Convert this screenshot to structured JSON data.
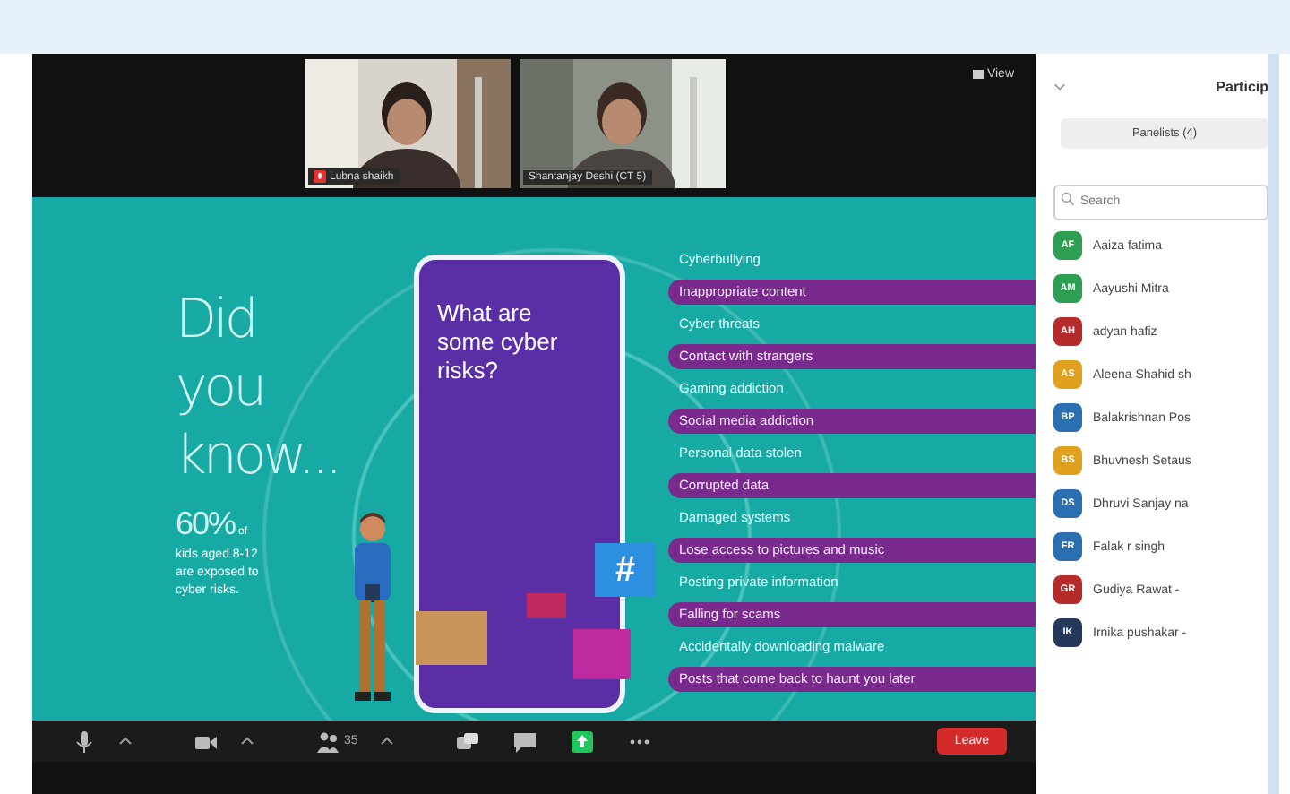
{
  "videos": [
    {
      "name": "Lubna shaikh",
      "muted": true
    },
    {
      "name": "Shantanjay Deshi (CT 5)",
      "muted": false
    }
  ],
  "view_button": "View",
  "slide": {
    "heading": [
      "Did",
      "you",
      "know..."
    ],
    "stat": "60%",
    "stat_suffix": "of",
    "stat_text": "kids aged 8-12 are exposed to cyber risks.",
    "phone_question": "What are some cyber risks?",
    "hashtag": "#",
    "risks": [
      {
        "text": "Cyberbullying",
        "kind": "plain"
      },
      {
        "text": "Inappropriate content",
        "kind": "bar"
      },
      {
        "text": "Cyber threats",
        "kind": "plain"
      },
      {
        "text": "Contact with strangers",
        "kind": "bar"
      },
      {
        "text": "Gaming addiction",
        "kind": "plain"
      },
      {
        "text": "Social media addiction",
        "kind": "bar"
      },
      {
        "text": "Personal data stolen",
        "kind": "plain"
      },
      {
        "text": "Corrupted data",
        "kind": "bar"
      },
      {
        "text": "Damaged systems",
        "kind": "plain"
      },
      {
        "text": "Lose access to pictures and music",
        "kind": "bar"
      },
      {
        "text": "Posting private information",
        "kind": "plain"
      },
      {
        "text": "Falling for scams",
        "kind": "bar"
      },
      {
        "text": "Accidentally downloading malware",
        "kind": "plain"
      },
      {
        "text": "Posts that come back to haunt you later",
        "kind": "bar"
      }
    ]
  },
  "toolbar": [
    {
      "kind": "mic",
      "caret": true
    },
    {
      "kind": "video",
      "caret": true
    },
    {
      "kind": "participants",
      "count": "35",
      "caret": true
    },
    {
      "kind": "poll",
      "caret": false
    },
    {
      "kind": "chat",
      "caret": false
    },
    {
      "kind": "share",
      "caret": false
    },
    {
      "kind": "more",
      "caret": false
    }
  ],
  "leave_button": "Leave",
  "panel": {
    "title": "Particip",
    "tab": "Panelists (4)",
    "search": {
      "placeholder": "Search"
    },
    "participants": [
      {
        "initials": "AF",
        "name": "Aaiza fatima",
        "color": "#2e9e52"
      },
      {
        "initials": "AM",
        "name": "Aayushi Mitra",
        "color": "#2e9e52"
      },
      {
        "initials": "AH",
        "name": "adyan hafiz",
        "color": "#b52a2a"
      },
      {
        "initials": "AS",
        "name": "Aleena Shahid sh",
        "color": "#e0a020"
      },
      {
        "initials": "BP",
        "name": "Balakrishnan Pos",
        "color": "#2a6fb0"
      },
      {
        "initials": "BS",
        "name": "Bhuvnesh Setaus",
        "color": "#e0a020"
      },
      {
        "initials": "DS",
        "name": "Dhruvi Sanjay na",
        "color": "#2a6fb0"
      },
      {
        "initials": "FR",
        "name": "Falak r singh",
        "color": "#2a6fb0"
      },
      {
        "initials": "GR",
        "name": "Gudiya Rawat -",
        "color": "#b52a2a"
      },
      {
        "initials": "IK",
        "name": "Irnika pushakar -",
        "color": "#24385a"
      }
    ]
  }
}
